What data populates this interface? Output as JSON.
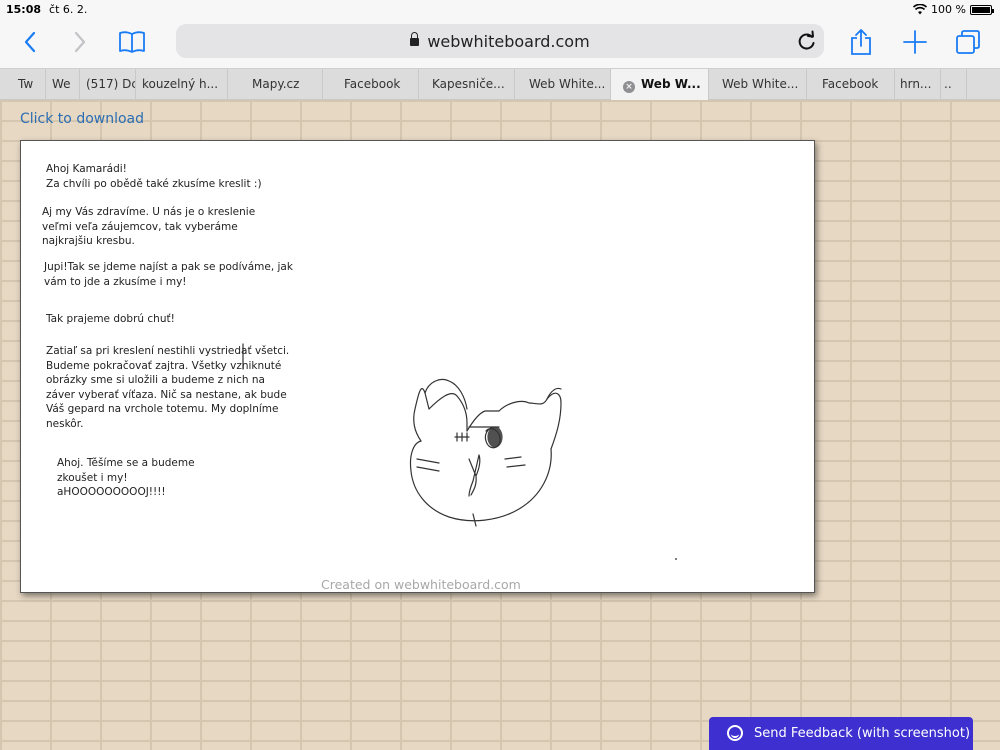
{
  "status_bar": {
    "time": "15:08",
    "date": "čt 6. 2.",
    "battery": "100 %"
  },
  "browser": {
    "url": "webwhiteboard.com",
    "tabs": [
      {
        "label": "Tw"
      },
      {
        "label": "We"
      },
      {
        "label": "(517) Dc"
      },
      {
        "label": "kouzelný h..."
      },
      {
        "label": "Mapy.cz"
      },
      {
        "label": "Facebook"
      },
      {
        "label": "Kapesniče..."
      },
      {
        "label": "Web White..."
      },
      {
        "label": "Web W..."
      },
      {
        "label": "Web White..."
      },
      {
        "label": "Facebook"
      },
      {
        "label": "hrn..."
      },
      {
        "label": ".."
      }
    ]
  },
  "page": {
    "download_link": "Click to download",
    "watermark": "Created on webwhiteboard.com",
    "notes": [
      "Ahoj Kamarádi!\nZa chvíli po obědě také zkusíme kreslit :)",
      "Aj my Vás zdravíme. U nás je o kreslenie\nveľmi veľa záujemcov, tak vyberáme\nnajkrajšiu kresbu.",
      "Jupi!Tak se jdeme najíst a pak se podíváme, jak\nvám to jde a zkusíme i my!",
      "Tak prajeme dobrú chuť!",
      "Zatiaľ sa pri kreslení nestihli vystriedať všetci.\nBudeme pokračovať zajtra. Všetky vzniknuté\nobrázky sme si uložili a budeme z nich na\nzáver vyberať víťaza. Nič sa nestane, ak bude\nVáš gepard na vrchole totemu. My doplníme\nneskôr.",
      "Ahoj. Těšíme se a budeme\nzkoušet i my!\naHOOOOOOOOOJ!!!!"
    ],
    "feedback_button": "Send Feedback (with screenshot)"
  }
}
